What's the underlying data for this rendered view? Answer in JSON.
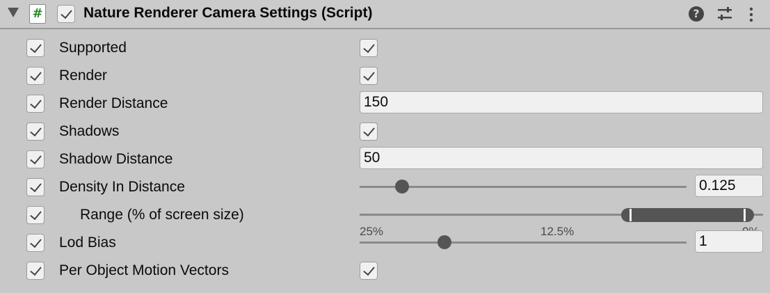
{
  "header": {
    "title": "Nature Renderer Camera Settings (Script)",
    "script_icon_glyph": "#",
    "enabled": true,
    "icons": [
      "foldout-arrow-icon",
      "script-icon",
      "help-icon",
      "presets-icon",
      "more-icon"
    ]
  },
  "rows": [
    {
      "label": "Supported",
      "type": "toggle",
      "value": true,
      "override": true
    },
    {
      "label": "Render",
      "type": "toggle",
      "value": true,
      "override": true
    },
    {
      "label": "Render Distance",
      "type": "number",
      "value": "150",
      "override": true
    },
    {
      "label": "Shadows",
      "type": "toggle",
      "value": true,
      "override": true
    },
    {
      "label": "Shadow Distance",
      "type": "number",
      "value": "50",
      "override": true
    },
    {
      "label": "Density In Distance",
      "type": "slider",
      "value": "0.125",
      "fraction": 0.13,
      "override": true
    },
    {
      "label": "Range (% of screen size)",
      "type": "minmax",
      "ticks": [
        "25%",
        "12.5%",
        "0%"
      ],
      "range_fraction": [
        0.65,
        0.98
      ],
      "override": true
    },
    {
      "label": "Lod Bias",
      "type": "slider",
      "value": "1",
      "fraction": 0.26,
      "override": true
    },
    {
      "label": "Per Object Motion Vectors",
      "type": "toggle",
      "value": true,
      "override": true
    }
  ],
  "colors": {
    "background": "#c8c8c8",
    "field": "#f0f0f0",
    "thumb": "#555555",
    "script_icon": "#2c8a2c"
  }
}
